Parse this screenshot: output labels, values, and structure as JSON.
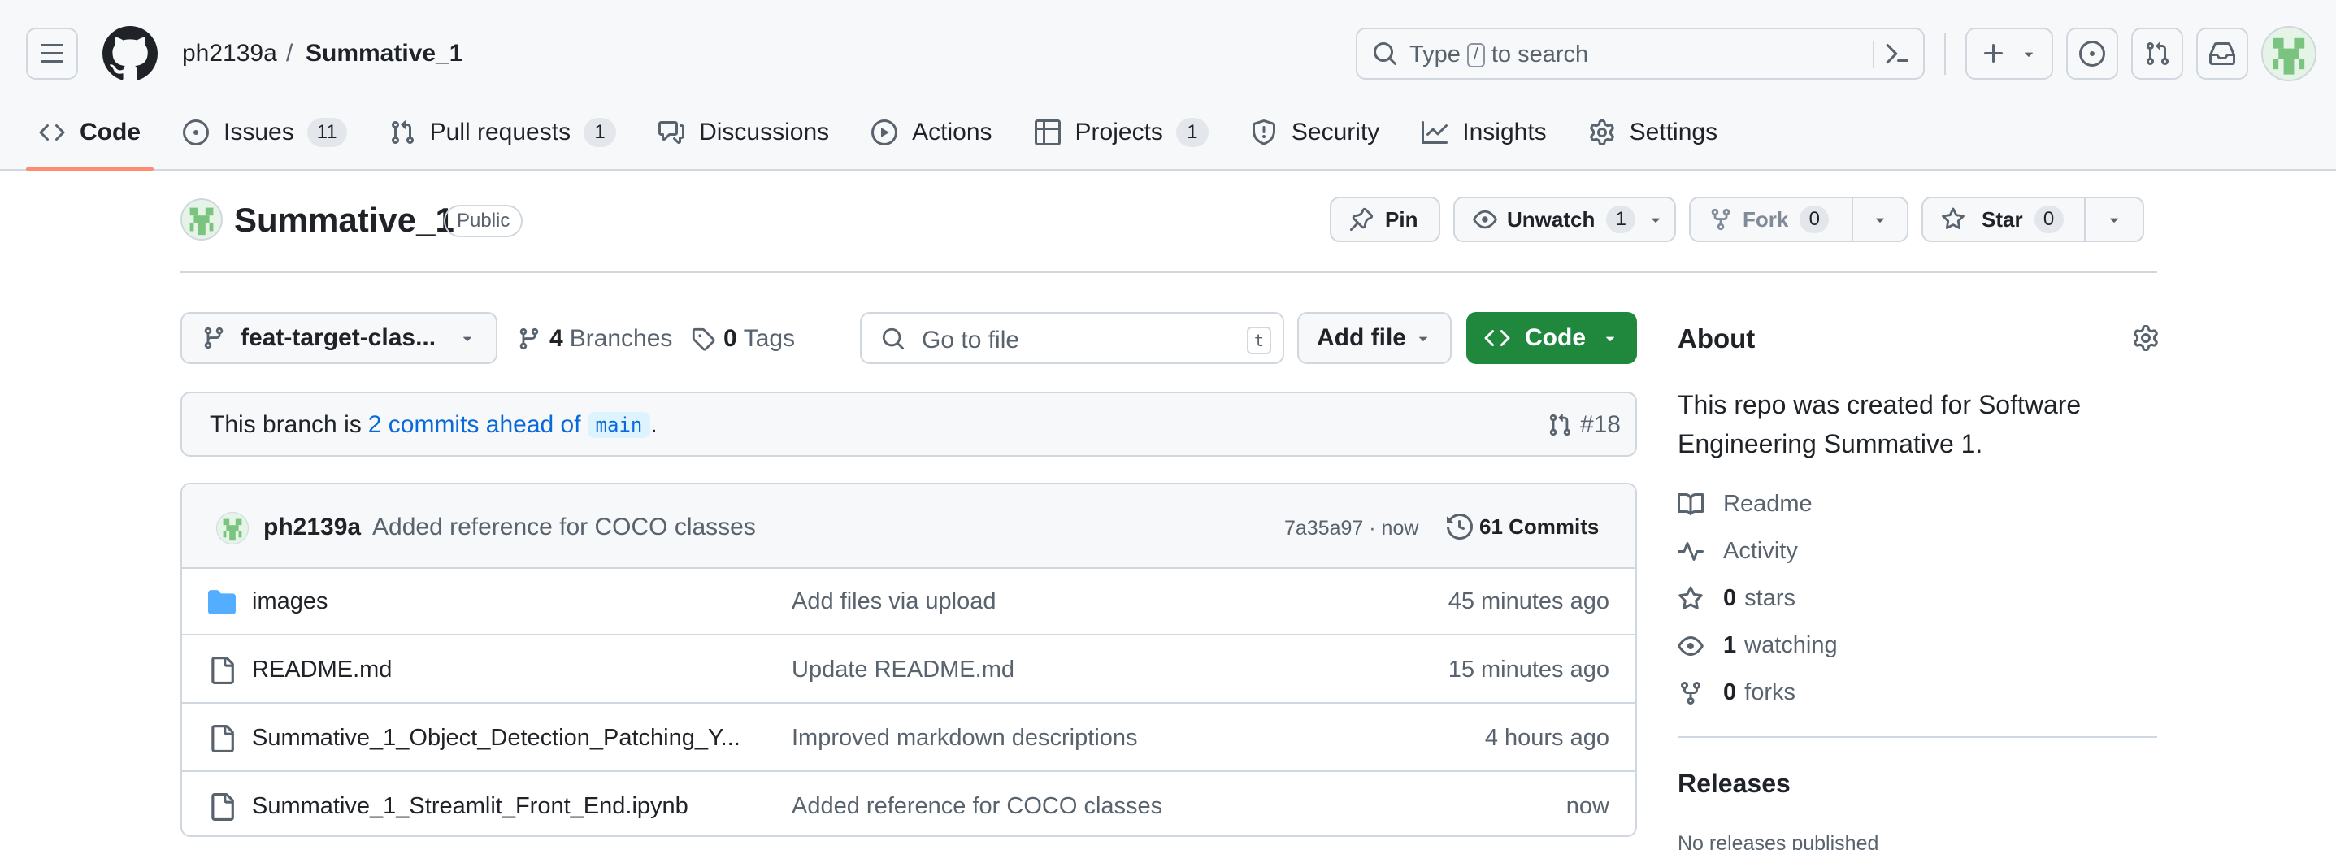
{
  "header": {
    "owner": "ph2139a",
    "separator": "/",
    "repo": "Summative_1",
    "search_prefix": "Type",
    "search_key": "/",
    "search_suffix": "to search",
    "icons": [
      "menu-icon",
      "github-logo-icon",
      "search-icon",
      "command-palette-icon",
      "plus-icon",
      "issues-icon",
      "pull-requests-icon",
      "inbox-icon",
      "user-avatar"
    ]
  },
  "repo_nav": {
    "code": "Code",
    "issues": "Issues",
    "issues_count": "11",
    "pulls": "Pull requests",
    "pulls_count": "1",
    "discussions": "Discussions",
    "actions": "Actions",
    "projects": "Projects",
    "projects_count": "1",
    "security": "Security",
    "insights": "Insights",
    "settings": "Settings"
  },
  "repo_title": {
    "name": "Summative_1",
    "visibility": "Public"
  },
  "actions": {
    "pin": "Pin",
    "unwatch": "Unwatch",
    "watch_count": "1",
    "fork": "Fork",
    "fork_count": "0",
    "star": "Star",
    "star_count": "0"
  },
  "toolbar": {
    "branch": "feat-target-clas...",
    "branches_count": "4",
    "branches_label": "Branches",
    "tags_count": "0",
    "tags_label": "Tags",
    "goto_placeholder": "Go to file",
    "goto_key": "t",
    "add_file": "Add file",
    "code": "Code"
  },
  "branch_info": {
    "prefix": "This branch is",
    "ahead_link": "2 commits ahead of",
    "base_branch": "main",
    "suffix": ".",
    "pr_ref": "#18"
  },
  "latest_commit": {
    "author": "ph2139a",
    "message": "Added reference for COCO classes",
    "hash_time": "7a35a97 · now",
    "commits_label": "61 Commits"
  },
  "files": [
    {
      "name": "images",
      "type": "folder",
      "message": "Add files via upload",
      "time": "45 minutes ago"
    },
    {
      "name": "README.md",
      "type": "file",
      "message": "Update README.md",
      "time": "15 minutes ago"
    },
    {
      "name": "Summative_1_Object_Detection_Patching_Y...",
      "type": "file",
      "message": "Improved markdown descriptions",
      "time": "4 hours ago"
    },
    {
      "name": "Summative_1_Streamlit_Front_End.ipynb",
      "type": "file",
      "message": "Added reference for COCO classes",
      "time": "now"
    }
  ],
  "about": {
    "title": "About",
    "description": "This repo was created for Software Engineering Summative 1.",
    "readme": "Readme",
    "activity": "Activity",
    "stars_count": "0",
    "stars_label": "stars",
    "watching_count": "1",
    "watching_label": "watching",
    "forks_count": "0",
    "forks_label": "forks"
  },
  "releases": {
    "title": "Releases",
    "subtitle": "No releases published"
  },
  "colors": {
    "accent_underline": "#fd8c73",
    "code_button": "#1f883d",
    "link": "#0969da",
    "folder": "#54aeff"
  }
}
